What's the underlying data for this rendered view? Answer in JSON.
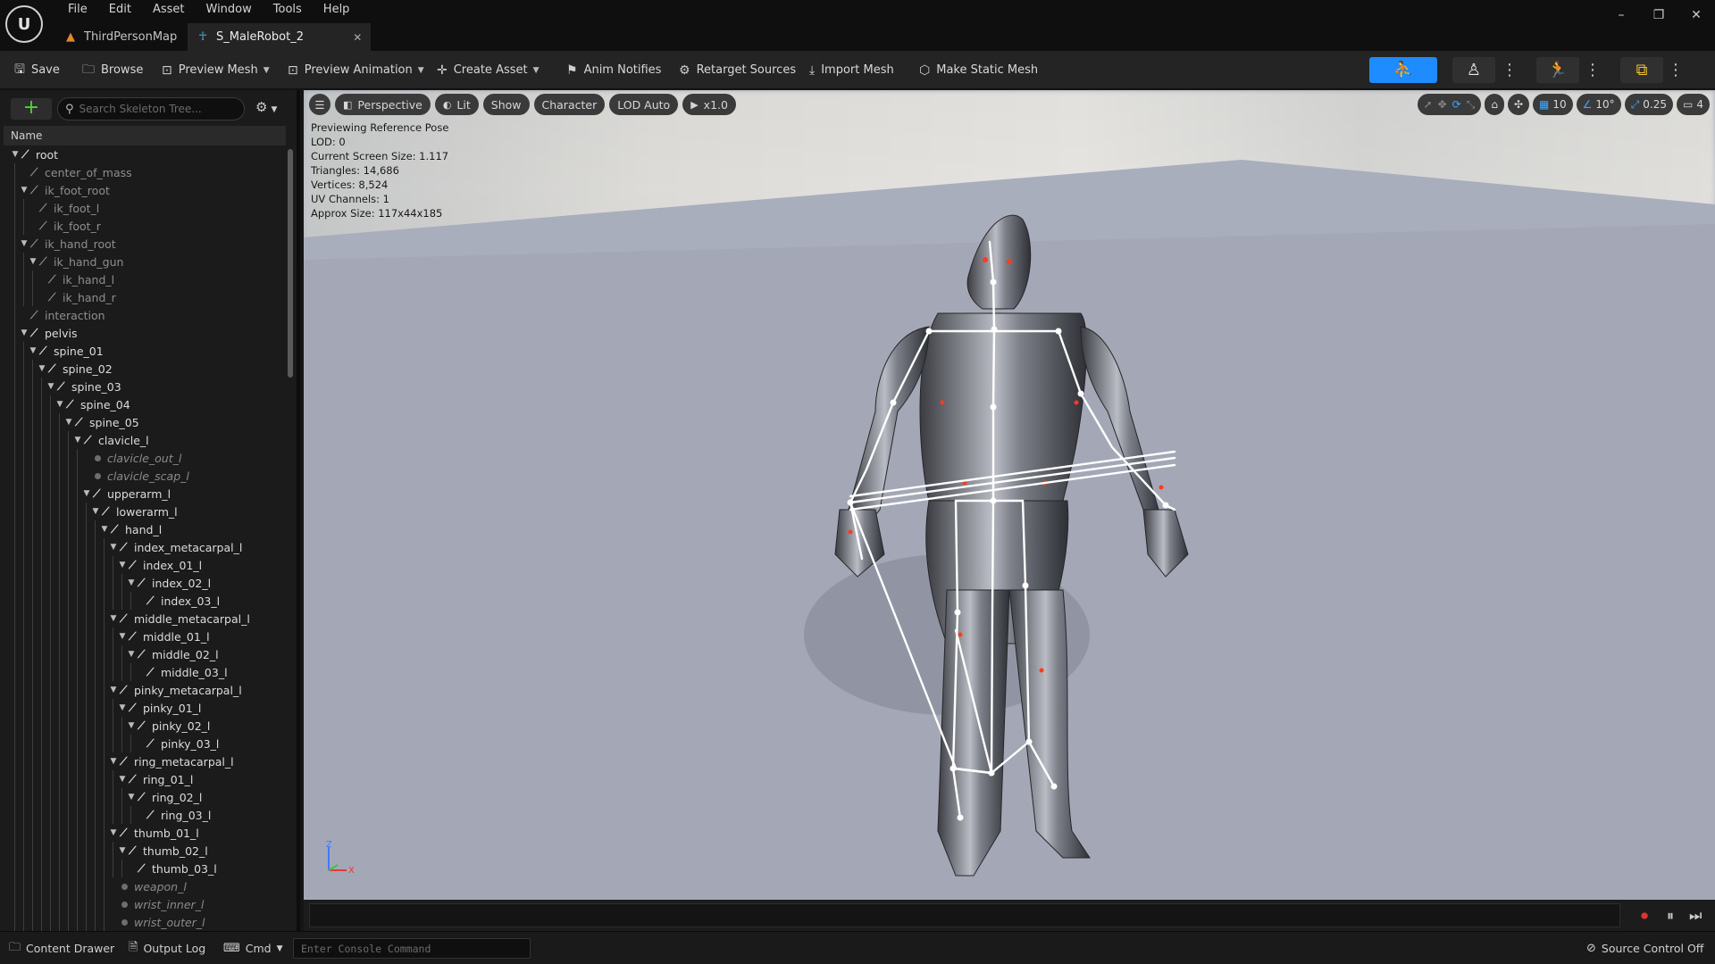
{
  "app": {
    "menu": [
      "File",
      "Edit",
      "Asset",
      "Window",
      "Tools",
      "Help"
    ],
    "tabs": [
      {
        "label": "ThirdPersonMap",
        "icon": "level-icon",
        "active": false
      },
      {
        "label": "S_MaleRobot_2",
        "icon": "skeleton-icon",
        "active": true
      }
    ],
    "window_controls": [
      "minimize",
      "restore",
      "close"
    ]
  },
  "toolbar": {
    "save": "Save",
    "browse": "Browse",
    "preview_mesh": "Preview Mesh",
    "preview_animation": "Preview Animation",
    "create_asset": "Create Asset",
    "anim_notifies": "Anim Notifies",
    "retarget_sources": "Retarget Sources",
    "import_mesh": "Import Mesh",
    "make_static_mesh": "Make Static Mesh",
    "accent_color": "#1e8bff"
  },
  "skeleton_tree": {
    "search_placeholder": "Search Skeleton Tree...",
    "column_header": "Name",
    "rows": [
      {
        "label": "root",
        "depth": 0,
        "kind": "bone",
        "expanded": true
      },
      {
        "label": "center_of_mass",
        "depth": 1,
        "kind": "virtual"
      },
      {
        "label": "ik_foot_root",
        "depth": 1,
        "kind": "virtual",
        "expanded": true
      },
      {
        "label": "ik_foot_l",
        "depth": 2,
        "kind": "virtual"
      },
      {
        "label": "ik_foot_r",
        "depth": 2,
        "kind": "virtual"
      },
      {
        "label": "ik_hand_root",
        "depth": 1,
        "kind": "virtual",
        "expanded": true
      },
      {
        "label": "ik_hand_gun",
        "depth": 2,
        "kind": "virtual",
        "expanded": true
      },
      {
        "label": "ik_hand_l",
        "depth": 3,
        "kind": "virtual"
      },
      {
        "label": "ik_hand_r",
        "depth": 3,
        "kind": "virtual"
      },
      {
        "label": "interaction",
        "depth": 1,
        "kind": "virtual"
      },
      {
        "label": "pelvis",
        "depth": 1,
        "kind": "bone",
        "expanded": true
      },
      {
        "label": "spine_01",
        "depth": 2,
        "kind": "bone",
        "expanded": true
      },
      {
        "label": "spine_02",
        "depth": 3,
        "kind": "bone",
        "expanded": true
      },
      {
        "label": "spine_03",
        "depth": 4,
        "kind": "bone",
        "expanded": true
      },
      {
        "label": "spine_04",
        "depth": 5,
        "kind": "bone",
        "expanded": true
      },
      {
        "label": "spine_05",
        "depth": 6,
        "kind": "bone",
        "expanded": true
      },
      {
        "label": "clavicle_l",
        "depth": 7,
        "kind": "bone",
        "expanded": true
      },
      {
        "label": "clavicle_out_l",
        "depth": 8,
        "kind": "socket"
      },
      {
        "label": "clavicle_scap_l",
        "depth": 8,
        "kind": "socket"
      },
      {
        "label": "upperarm_l",
        "depth": 8,
        "kind": "bone",
        "expanded": true
      },
      {
        "label": "lowerarm_l",
        "depth": 9,
        "kind": "bone",
        "expanded": true
      },
      {
        "label": "hand_l",
        "depth": 10,
        "kind": "bone",
        "expanded": true
      },
      {
        "label": "index_metacarpal_l",
        "depth": 11,
        "kind": "bone",
        "expanded": true
      },
      {
        "label": "index_01_l",
        "depth": 12,
        "kind": "bone",
        "expanded": true
      },
      {
        "label": "index_02_l",
        "depth": 13,
        "kind": "bone",
        "expanded": true
      },
      {
        "label": "index_03_l",
        "depth": 14,
        "kind": "bone"
      },
      {
        "label": "middle_metacarpal_l",
        "depth": 11,
        "kind": "bone",
        "expanded": true
      },
      {
        "label": "middle_01_l",
        "depth": 12,
        "kind": "bone",
        "expanded": true
      },
      {
        "label": "middle_02_l",
        "depth": 13,
        "kind": "bone",
        "expanded": true
      },
      {
        "label": "middle_03_l",
        "depth": 14,
        "kind": "bone"
      },
      {
        "label": "pinky_metacarpal_l",
        "depth": 11,
        "kind": "bone",
        "expanded": true
      },
      {
        "label": "pinky_01_l",
        "depth": 12,
        "kind": "bone",
        "expanded": true
      },
      {
        "label": "pinky_02_l",
        "depth": 13,
        "kind": "bone",
        "expanded": true
      },
      {
        "label": "pinky_03_l",
        "depth": 14,
        "kind": "bone"
      },
      {
        "label": "ring_metacarpal_l",
        "depth": 11,
        "kind": "bone",
        "expanded": true
      },
      {
        "label": "ring_01_l",
        "depth": 12,
        "kind": "bone",
        "expanded": true
      },
      {
        "label": "ring_02_l",
        "depth": 13,
        "kind": "bone",
        "expanded": true
      },
      {
        "label": "ring_03_l",
        "depth": 14,
        "kind": "bone"
      },
      {
        "label": "thumb_01_l",
        "depth": 11,
        "kind": "bone",
        "expanded": true
      },
      {
        "label": "thumb_02_l",
        "depth": 12,
        "kind": "bone",
        "expanded": true
      },
      {
        "label": "thumb_03_l",
        "depth": 13,
        "kind": "bone"
      },
      {
        "label": "weapon_l",
        "depth": 11,
        "kind": "socket"
      },
      {
        "label": "wrist_inner_l",
        "depth": 11,
        "kind": "socket"
      },
      {
        "label": "wrist_outer_l",
        "depth": 11,
        "kind": "socket"
      }
    ]
  },
  "viewport": {
    "buttons": {
      "perspective": "Perspective",
      "lit": "Lit",
      "show": "Show",
      "character": "Character",
      "lod": "LOD Auto",
      "speed": "x1.0"
    },
    "right_controls": {
      "grid_snap": "10",
      "rotation_snap": "10°",
      "scale_snap": "0.25",
      "camera_speed": "4"
    },
    "stats": [
      "Previewing Reference Pose",
      "LOD: 0",
      "Current Screen Size: 1.117",
      "Triangles: 14,686",
      "Vertices: 8,524",
      "UV Channels: 1",
      "Approx Size: 117x44x185"
    ],
    "axis_labels": {
      "z": "Z",
      "x": "X"
    }
  },
  "statusbar": {
    "content_drawer": "Content Drawer",
    "output_log": "Output Log",
    "cmd": "Cmd",
    "console_placeholder": "Enter Console Command",
    "source_control": "Source Control Off"
  }
}
